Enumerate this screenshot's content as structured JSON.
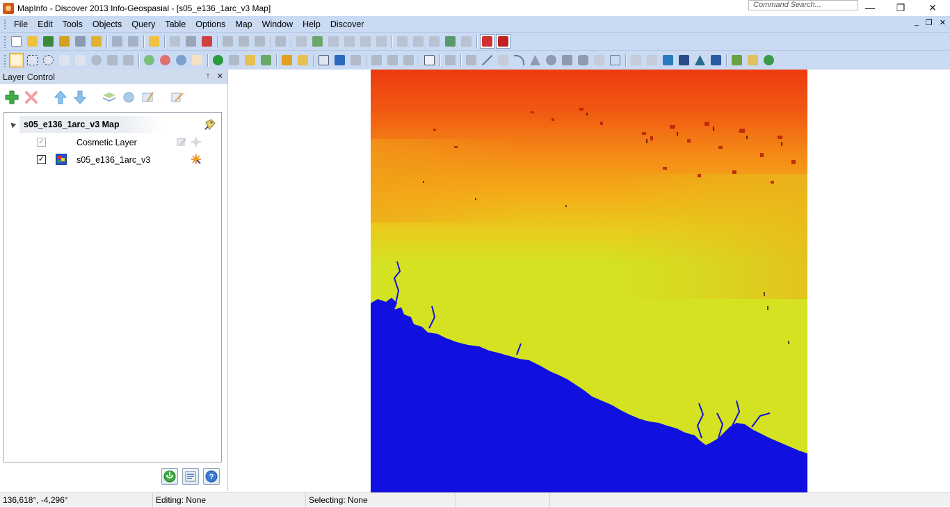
{
  "window": {
    "title": "MapInfo - Discover 2013    Info-Geospasial - [s05_e136_1arc_v3 Map]",
    "command_search_placeholder": "Command Search...",
    "minimize": "—",
    "restore": "❐",
    "close": "✕"
  },
  "menu": {
    "items": [
      "File",
      "Edit",
      "Tools",
      "Objects",
      "Query",
      "Table",
      "Options",
      "Map",
      "Window",
      "Help",
      "Discover"
    ],
    "mdi_minimize": "_",
    "mdi_restore": "❐",
    "mdi_close": "✕"
  },
  "layer_control": {
    "title": "Layer Control",
    "pin": "↑",
    "close": "✕",
    "map_name": "s05_e136_1arc_v3 Map",
    "layers": [
      {
        "name": "Cosmetic Layer",
        "checked": true,
        "enabled": false
      },
      {
        "name": "s05_e136_1arc_v3",
        "checked": true,
        "enabled": true
      }
    ],
    "check_glyph": "✓"
  },
  "status": {
    "coords": "136,618°, -4,296°",
    "editing": "Editing: None",
    "selecting": "Selecting: None"
  },
  "colors": {
    "toolbar_bg": "#c9daf2",
    "panel_header_bg": "#cfdcee",
    "sea": "#1010e0",
    "lowland": "#d4e222",
    "highland": "#ee3a10"
  }
}
